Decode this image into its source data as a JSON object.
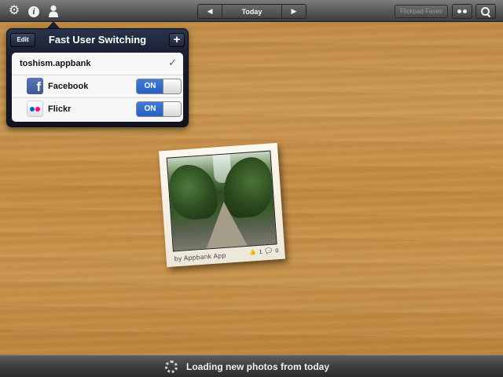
{
  "toolbar": {
    "date_label": "Today",
    "faves_label": "Flickpad Faves",
    "prev_arrow": "◀",
    "next_arrow": "▶",
    "icons": [
      "gear-icon",
      "info-icon",
      "user-icon",
      "flickr-icon",
      "search-icon"
    ]
  },
  "popover": {
    "title": "Fast User Switching",
    "edit_label": "Edit",
    "add_label": "+",
    "account": {
      "name": "toshism.appbank",
      "selected": true,
      "check": "✓"
    },
    "services": [
      {
        "name": "Facebook",
        "icon": "facebook-icon",
        "toggle": "ON",
        "enabled": true
      },
      {
        "name": "Flickr",
        "icon": "flickr-icon",
        "toggle": "ON",
        "enabled": true
      }
    ]
  },
  "photo": {
    "caption": "by Appbank App",
    "likes": "1",
    "comments": "0"
  },
  "status": {
    "text": "Loading new photos from today"
  },
  "colors": {
    "popover_bg": "#161c2d",
    "switch_on": "#2760c3",
    "wood": "#c48c43",
    "facebook": "#3b5998"
  }
}
